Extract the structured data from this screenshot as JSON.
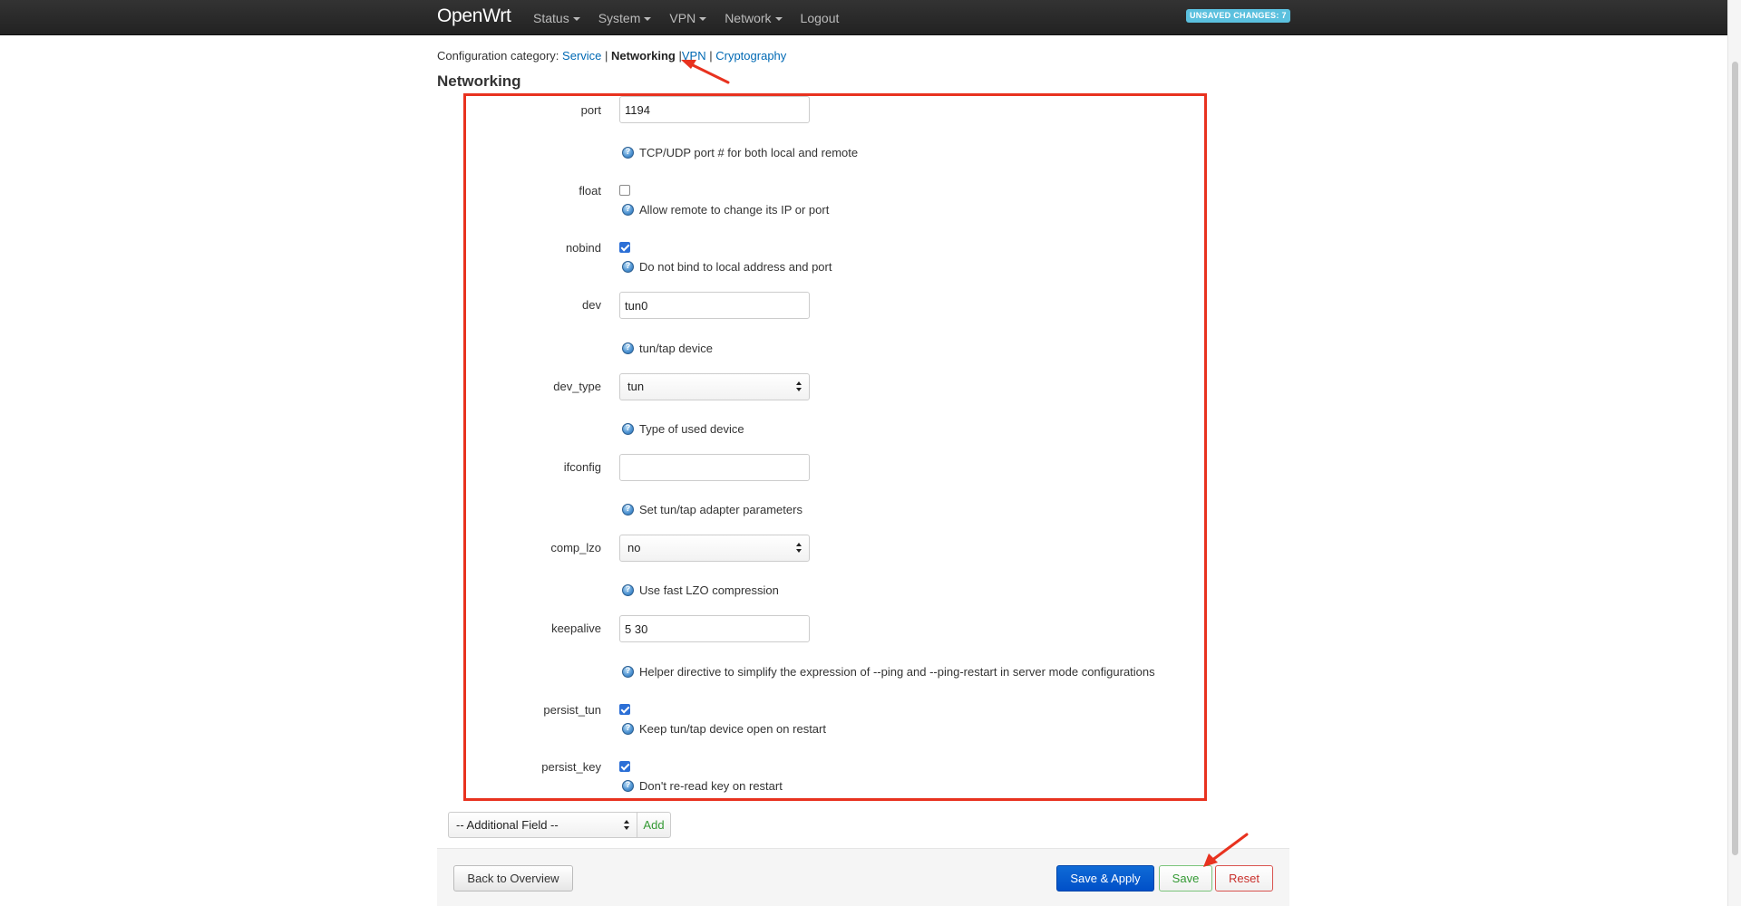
{
  "navbar": {
    "brand": "OpenWrt",
    "menu": [
      {
        "label": "Status",
        "has_dropdown": true
      },
      {
        "label": "System",
        "has_dropdown": true
      },
      {
        "label": "VPN",
        "has_dropdown": true
      },
      {
        "label": "Network",
        "has_dropdown": true
      },
      {
        "label": "Logout",
        "has_dropdown": false
      }
    ],
    "badge": "UNSAVED CHANGES: 7"
  },
  "category": {
    "prefix": "Configuration category:",
    "items": [
      "Service",
      "Networking",
      "VPN",
      "Cryptography"
    ],
    "active": "Networking",
    "separator": "|"
  },
  "section_title": "Networking",
  "fields": {
    "port": {
      "label": "port",
      "value": "1194",
      "help": "TCP/UDP port # for both local and remote"
    },
    "float": {
      "label": "float",
      "checked": false,
      "help": "Allow remote to change its IP or port"
    },
    "nobind": {
      "label": "nobind",
      "checked": true,
      "help": "Do not bind to local address and port"
    },
    "dev": {
      "label": "dev",
      "value": "tun0",
      "help": "tun/tap device"
    },
    "dev_type": {
      "label": "dev_type",
      "value": "tun",
      "help": "Type of used device"
    },
    "ifconfig": {
      "label": "ifconfig",
      "value": "",
      "help": "Set tun/tap adapter parameters"
    },
    "comp_lzo": {
      "label": "comp_lzo",
      "value": "no",
      "help": "Use fast LZO compression"
    },
    "keepalive": {
      "label": "keepalive",
      "value": "5 30",
      "help": "Helper directive to simplify the expression of --ping and --ping-restart in server mode configurations"
    },
    "persist_tun": {
      "label": "persist_tun",
      "checked": true,
      "help": "Keep tun/tap device open on restart"
    },
    "persist_key": {
      "label": "persist_key",
      "checked": true,
      "help": "Don't re-read key on restart"
    }
  },
  "additional_field": {
    "placeholder": "-- Additional Field --",
    "add_label": "Add"
  },
  "actions": {
    "back": "Back to Overview",
    "save_apply": "Save & Apply",
    "save": "Save",
    "reset": "Reset"
  },
  "colors": {
    "navbar_bg": "#222222",
    "link": "#0069b4",
    "annotation_red": "#e8321f",
    "badge_bg": "#5bc0de",
    "primary_button": "#0050c8",
    "save_green": "#339933",
    "reset_red": "#c9302c"
  }
}
